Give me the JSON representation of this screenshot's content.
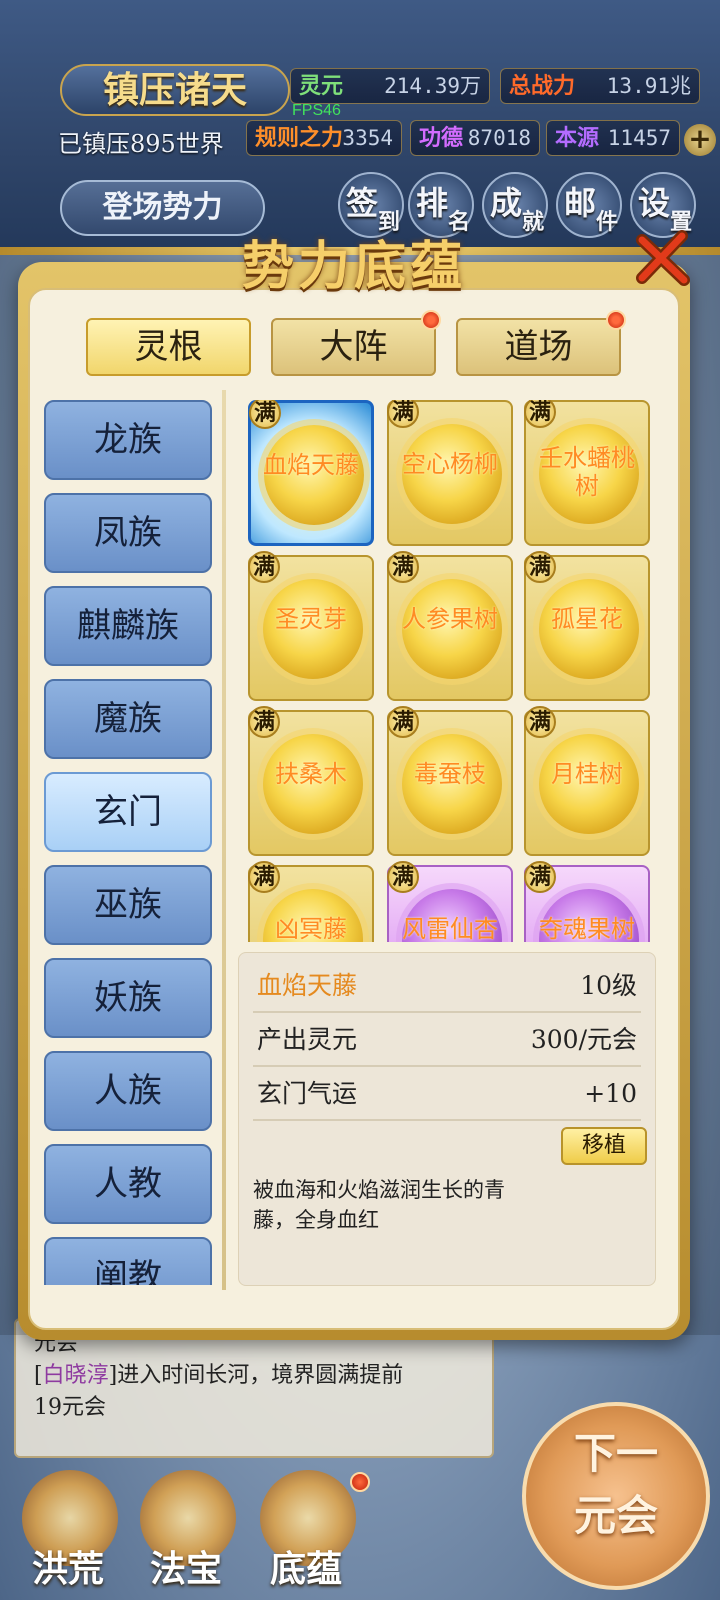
{
  "hud": {
    "title": "镇压诸天",
    "world_count": "已镇压895世界",
    "fps": "FPS46",
    "stats": {
      "lingyuan": {
        "label": "灵元",
        "value": "214.39万"
      },
      "power": {
        "label": "总战力",
        "value": "13.91兆"
      },
      "rule": {
        "label": "规则之力",
        "value": "3354"
      },
      "merit": {
        "label": "功德",
        "value": "87018"
      },
      "origin": {
        "label": "本源",
        "value": "11457"
      }
    },
    "plus_label": "+",
    "stage_button": "登场势力",
    "shortcuts": [
      {
        "big": "签",
        "small": "到"
      },
      {
        "big": "排",
        "small": "名"
      },
      {
        "big": "成",
        "small": "就"
      },
      {
        "big": "邮",
        "small": "件"
      },
      {
        "big": "设",
        "small": "置"
      }
    ]
  },
  "modal": {
    "title": "势力底蕴",
    "tabs": [
      "灵根",
      "大阵",
      "道场"
    ],
    "sidebar": [
      "龙族",
      "凤族",
      "麒麟族",
      "魔族",
      "玄门",
      "巫族",
      "妖族",
      "人族",
      "人教",
      "阐教"
    ],
    "badge": "满",
    "items": [
      {
        "name": "血焰天藤"
      },
      {
        "name": "空心杨柳"
      },
      {
        "name": "壬水蟠桃树"
      },
      {
        "name": "圣灵芽"
      },
      {
        "name": "人参果树"
      },
      {
        "name": "孤星花"
      },
      {
        "name": "扶桑木"
      },
      {
        "name": "毒蚕枝"
      },
      {
        "name": "月桂树"
      },
      {
        "name": "凶冥藤"
      },
      {
        "name": "风雷仙杏"
      },
      {
        "name": "夺魂果树"
      }
    ],
    "detail": {
      "name": "血焰天藤",
      "level": "10级",
      "output_label": "产出灵元",
      "output_value": "300/元会",
      "luck_label": "玄门气运",
      "luck_value": "+10",
      "transplant": "移植",
      "description": "被血海和火焰滋润生长的青藤，全身血红"
    }
  },
  "feed": {
    "line0": "元会",
    "name": "白晓淳",
    "line1_rest": "进入时间长河，境界圆满提前",
    "line2": "19元会"
  },
  "bottom_nav": [
    "洪荒",
    "法宝",
    "底蕴"
  ],
  "next_era": {
    "line1": "下一",
    "line2": "元会"
  },
  "colors": {
    "accent_gold": "#f6cf6a",
    "sidebar_blue": "#6a90c8",
    "item_name_orange": "#ff8b23",
    "detail_name": "#e58a1f"
  }
}
